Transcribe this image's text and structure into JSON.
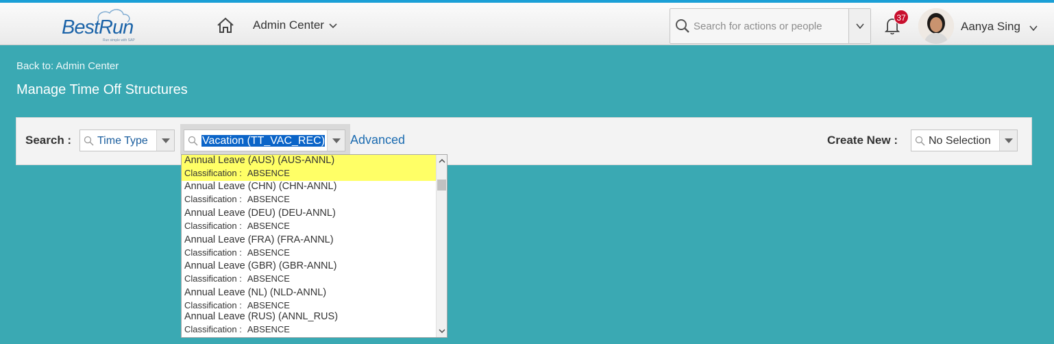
{
  "header": {
    "logo_text": "BestRun",
    "logo_tagline": "Run simple with SAP",
    "admin_menu_label": "Admin Center",
    "search_placeholder": "Search for actions or people",
    "notification_count": "37",
    "user_name": "Aanya Sing"
  },
  "page": {
    "back_link": "Back to: Admin Center",
    "title": "Manage Time Off Structures"
  },
  "search_panel": {
    "search_label": "Search :",
    "type_combo_value": "Time Type",
    "value_combo_value": "Vacation (TT_VAC_REC)",
    "advanced_link": "Advanced",
    "create_label": "Create New :",
    "create_combo_value": "No Selection"
  },
  "dropdown": {
    "classification_label": "Classification :",
    "items": [
      {
        "name": "Annual Leave (AUS) (AUS-ANNL)",
        "classification": "ABSENCE",
        "highlighted": true
      },
      {
        "name": "Annual Leave (CHN) (CHN-ANNL)",
        "classification": "ABSENCE"
      },
      {
        "name": "Annual Leave (DEU) (DEU-ANNL)",
        "classification": "ABSENCE"
      },
      {
        "name": "Annual Leave (FRA) (FRA-ANNL)",
        "classification": "ABSENCE"
      },
      {
        "name": "Annual Leave (GBR) (GBR-ANNL)",
        "classification": "ABSENCE"
      },
      {
        "name": "Annual Leave (NL) (NLD-ANNL)",
        "classification": "ABSENCE"
      },
      {
        "name": "Annual Leave (RUS) (ANNL_RUS)",
        "classification": "ABSENCE"
      }
    ]
  },
  "colors": {
    "background": "#3aa9b3",
    "accent": "#1a9fd6",
    "highlight": "#ffff66",
    "selection": "#0a64c8",
    "badge": "#c8102e"
  }
}
